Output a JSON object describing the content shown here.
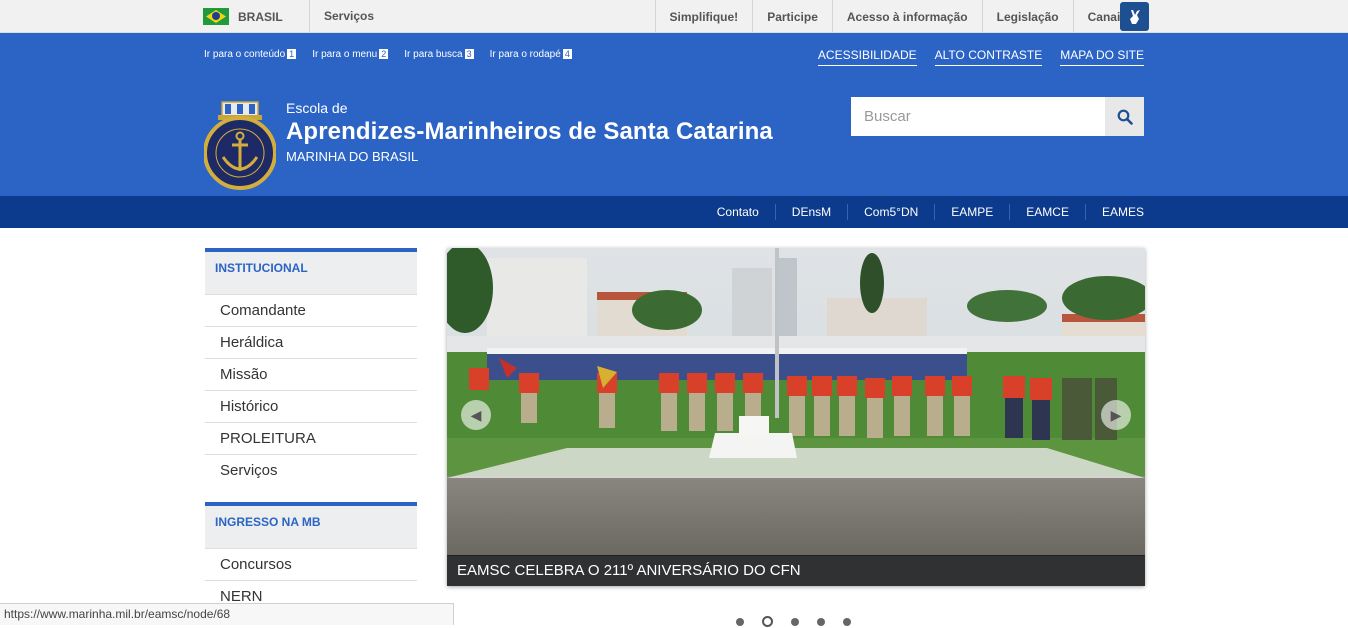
{
  "govbar": {
    "country": "BRASIL",
    "services": "Serviços",
    "links": [
      "Simplifique!",
      "Participe",
      "Acesso à informação",
      "Legislação",
      "Canais"
    ]
  },
  "skips": [
    {
      "label": "Ir para o conteúdo",
      "key": "1"
    },
    {
      "label": "Ir para o menu",
      "key": "2"
    },
    {
      "label": "Ir para busca",
      "key": "3"
    },
    {
      "label": "Ir para o rodapé",
      "key": "4"
    }
  ],
  "accessibility": [
    "ACESSIBILIDADE",
    "ALTO CONTRASTE",
    "MAPA DO SITE"
  ],
  "header": {
    "pre_title": "Escola de",
    "title": "Aprendizes-Marinheiros de Santa Catarina",
    "subtitle": "MARINHA DO BRASIL",
    "logo_text": "MARINHA DO BRASIL"
  },
  "search": {
    "placeholder": "Buscar"
  },
  "services_nav": [
    "Contato",
    "DEnsM",
    "Com5°DN",
    "EAMPE",
    "EAMCE",
    "EAMES"
  ],
  "sidebar": {
    "sections": [
      {
        "title": "INSTITUCIONAL",
        "items": [
          "Comandante",
          "Heráldica",
          "Missão",
          "Histórico",
          "PROLEITURA",
          "Serviços"
        ]
      },
      {
        "title": "INGRESSO NA MB",
        "items": [
          "Concursos",
          "NERN"
        ]
      }
    ]
  },
  "carousel": {
    "caption": "EAMSC CELEBRA O 211º ANIVERSÁRIO DO CFN",
    "slides": 5,
    "active_slide": 2
  },
  "status_url": "https://www.marinha.mil.br/eamsc/node/68",
  "colors": {
    "primary": "#2b64c5",
    "dark_nav": "#0c3a8c"
  }
}
